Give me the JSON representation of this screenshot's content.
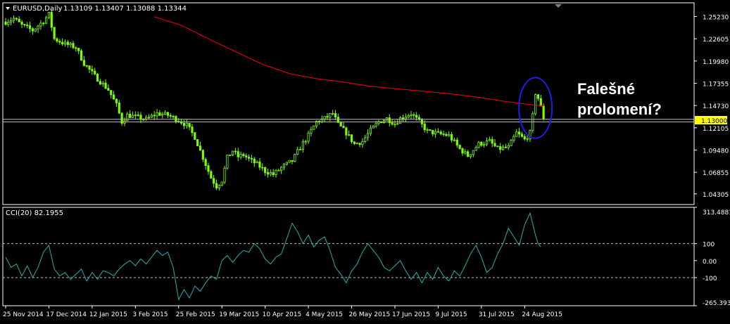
{
  "header": {
    "symbol": "EURUSD,Daily",
    "ohlc": "1.13109 1.13407 1.13088 1.13344"
  },
  "indicator": {
    "label": "CCI(20) 82.1955"
  },
  "annotation": {
    "line1": "Falešné",
    "line2": "prolomení?"
  },
  "colors": {
    "background": "#000000",
    "candle": "#7CFC00",
    "ma": "#FF0000",
    "cci": "#20B2AA",
    "level_lines": "#C0C0C0",
    "price_box": "#FFFF00",
    "highlight_ellipse": "#1E1EE6",
    "text": "#FFFFFF"
  },
  "chart_data": [
    {
      "type": "candlestick",
      "title": "EURUSD,Daily",
      "ylim": [
        1.0305,
        1.2685
      ],
      "y_ticks": [
        "1.25230",
        "1.22605",
        "1.19980",
        "1.17355",
        "1.14730",
        "1.12105",
        "1.09480",
        "1.06855",
        "1.04305"
      ],
      "y_tick_values": [
        1.2523,
        1.22605,
        1.1998,
        1.17355,
        1.1473,
        1.12105,
        1.0948,
        1.06855,
        1.04305
      ],
      "current_price_label": "1.13000",
      "current_price": 1.13,
      "horizontal_levels": [
        1.131,
        1.128
      ],
      "x_labels": [
        "25 Nov 2014",
        "17 Dec 2014",
        "12 Jan 2015",
        "3 Feb 2015",
        "25 Feb 2015",
        "19 Mar 2015",
        "10 Apr 2015",
        "4 May 2015",
        "26 May 2015",
        "17 Jun 2015",
        "9 Jul 2015",
        "31 Jul 2015",
        "24 Aug 2015"
      ],
      "x_label_bars": [
        0,
        16,
        32,
        48,
        64,
        80,
        96,
        112,
        128,
        144,
        160,
        176,
        192
      ],
      "close_keypoints": [
        [
          0,
          1.246
        ],
        [
          3,
          1.25
        ],
        [
          6,
          1.242
        ],
        [
          10,
          1.236
        ],
        [
          14,
          1.247
        ],
        [
          16,
          1.255
        ],
        [
          18,
          1.226
        ],
        [
          22,
          1.22
        ],
        [
          26,
          1.216
        ],
        [
          29,
          1.197
        ],
        [
          33,
          1.182
        ],
        [
          38,
          1.166
        ],
        [
          41,
          1.148
        ],
        [
          43,
          1.128
        ],
        [
          45,
          1.136
        ],
        [
          48,
          1.134
        ],
        [
          52,
          1.131
        ],
        [
          56,
          1.138
        ],
        [
          60,
          1.136
        ],
        [
          64,
          1.13
        ],
        [
          67,
          1.124
        ],
        [
          70,
          1.11
        ],
        [
          73,
          1.086
        ],
        [
          76,
          1.062
        ],
        [
          78,
          1.052
        ],
        [
          80,
          1.059
        ],
        [
          82,
          1.086
        ],
        [
          84,
          1.094
        ],
        [
          86,
          1.087
        ],
        [
          88,
          1.089
        ],
        [
          90,
          1.084
        ],
        [
          93,
          1.078
        ],
        [
          96,
          1.07
        ],
        [
          99,
          1.066
        ],
        [
          102,
          1.074
        ],
        [
          106,
          1.082
        ],
        [
          109,
          1.098
        ],
        [
          112,
          1.112
        ],
        [
          115,
          1.128
        ],
        [
          118,
          1.132
        ],
        [
          121,
          1.138
        ],
        [
          123,
          1.125
        ],
        [
          126,
          1.115
        ],
        [
          129,
          1.102
        ],
        [
          132,
          1.105
        ],
        [
          135,
          1.118
        ],
        [
          138,
          1.128
        ],
        [
          141,
          1.132
        ],
        [
          144,
          1.126
        ],
        [
          146,
          1.132
        ],
        [
          150,
          1.138
        ],
        [
          153,
          1.128
        ],
        [
          156,
          1.117
        ],
        [
          160,
          1.114
        ],
        [
          164,
          1.112
        ],
        [
          168,
          1.096
        ],
        [
          171,
          1.088
        ],
        [
          175,
          1.102
        ],
        [
          179,
          1.105
        ],
        [
          182,
          1.096
        ],
        [
          186,
          1.098
        ],
        [
          189,
          1.115
        ],
        [
          192,
          1.107
        ],
        [
          194,
          1.115
        ],
        [
          195,
          1.135
        ],
        [
          196,
          1.162
        ],
        [
          197,
          1.156
        ],
        [
          198,
          1.145
        ],
        [
          199,
          1.133
        ]
      ],
      "ma_keypoints": [
        [
          55,
          1.252
        ],
        [
          65,
          1.242
        ],
        [
          75,
          1.226
        ],
        [
          85,
          1.211
        ],
        [
          95,
          1.196
        ],
        [
          105,
          1.185
        ],
        [
          115,
          1.179
        ],
        [
          125,
          1.175
        ],
        [
          135,
          1.17
        ],
        [
          145,
          1.167
        ],
        [
          155,
          1.164
        ],
        [
          165,
          1.161
        ],
        [
          175,
          1.157
        ],
        [
          185,
          1.152
        ],
        [
          195,
          1.148
        ],
        [
          199,
          1.147
        ]
      ],
      "highlight": {
        "from_bar": 193,
        "to_bar": 199,
        "from_price": 1.117,
        "to_price": 1.172
      }
    },
    {
      "type": "line",
      "title": "CCI(20) 82.1955",
      "ylim": [
        -265.393,
        313.4881
      ],
      "y_ticks": [
        "313.4881",
        "100",
        "0.00",
        "-100",
        "-265.3930"
      ],
      "y_tick_values": [
        313.4881,
        100,
        0,
        -100,
        -265.393
      ],
      "levels": [
        100,
        -100
      ],
      "keypoints": [
        [
          0,
          20
        ],
        [
          2,
          -40
        ],
        [
          4,
          -20
        ],
        [
          6,
          -90
        ],
        [
          8,
          -30
        ],
        [
          10,
          -100
        ],
        [
          12,
          -40
        ],
        [
          14,
          50
        ],
        [
          16,
          90
        ],
        [
          18,
          -50
        ],
        [
          20,
          -90
        ],
        [
          22,
          -70
        ],
        [
          24,
          -110
        ],
        [
          26,
          -80
        ],
        [
          28,
          -50
        ],
        [
          30,
          -120
        ],
        [
          32,
          -70
        ],
        [
          34,
          -110
        ],
        [
          36,
          -60
        ],
        [
          38,
          -70
        ],
        [
          40,
          -90
        ],
        [
          42,
          -50
        ],
        [
          44,
          -20
        ],
        [
          46,
          0
        ],
        [
          48,
          -30
        ],
        [
          50,
          10
        ],
        [
          52,
          -20
        ],
        [
          54,
          20
        ],
        [
          56,
          60
        ],
        [
          58,
          30
        ],
        [
          60,
          50
        ],
        [
          62,
          -40
        ],
        [
          64,
          -230
        ],
        [
          66,
          -170
        ],
        [
          68,
          -220
        ],
        [
          70,
          -150
        ],
        [
          72,
          -180
        ],
        [
          74,
          -130
        ],
        [
          76,
          -90
        ],
        [
          78,
          -110
        ],
        [
          80,
          0
        ],
        [
          82,
          30
        ],
        [
          84,
          -10
        ],
        [
          86,
          30
        ],
        [
          88,
          60
        ],
        [
          90,
          50
        ],
        [
          92,
          100
        ],
        [
          94,
          70
        ],
        [
          96,
          10
        ],
        [
          98,
          -20
        ],
        [
          100,
          20
        ],
        [
          102,
          40
        ],
        [
          104,
          130
        ],
        [
          106,
          220
        ],
        [
          108,
          170
        ],
        [
          110,
          100
        ],
        [
          112,
          150
        ],
        [
          114,
          80
        ],
        [
          116,
          120
        ],
        [
          118,
          140
        ],
        [
          120,
          60
        ],
        [
          122,
          -40
        ],
        [
          124,
          -80
        ],
        [
          126,
          -130
        ],
        [
          128,
          -60
        ],
        [
          130,
          -20
        ],
        [
          132,
          50
        ],
        [
          134,
          100
        ],
        [
          136,
          60
        ],
        [
          138,
          20
        ],
        [
          140,
          -40
        ],
        [
          142,
          -60
        ],
        [
          144,
          -30
        ],
        [
          146,
          0
        ],
        [
          148,
          -60
        ],
        [
          150,
          -110
        ],
        [
          152,
          -70
        ],
        [
          154,
          -130
        ],
        [
          156,
          -70
        ],
        [
          158,
          -110
        ],
        [
          160,
          -40
        ],
        [
          162,
          -90
        ],
        [
          164,
          -120
        ],
        [
          166,
          -60
        ],
        [
          168,
          -90
        ],
        [
          170,
          -30
        ],
        [
          172,
          40
        ],
        [
          174,
          90
        ],
        [
          176,
          20
        ],
        [
          178,
          -70
        ],
        [
          180,
          -40
        ],
        [
          182,
          40
        ],
        [
          184,
          100
        ],
        [
          186,
          190
        ],
        [
          188,
          140
        ],
        [
          190,
          90
        ],
        [
          192,
          210
        ],
        [
          194,
          280
        ],
        [
          196,
          150
        ],
        [
          197,
          100
        ],
        [
          198,
          82
        ]
      ]
    }
  ]
}
